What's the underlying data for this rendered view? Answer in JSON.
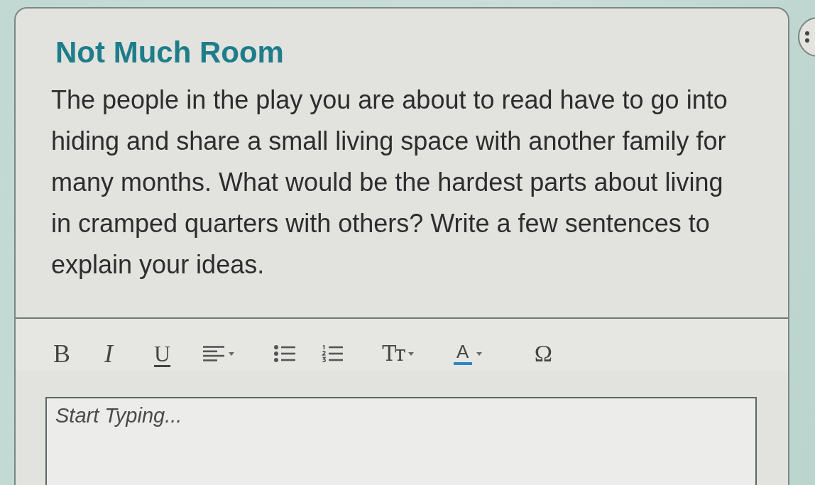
{
  "question": {
    "title": "Not Much Room",
    "prompt": "The people in the play you are about to read have to go into hiding and share a small living space with another family for many months. What would be the hardest parts about living in cramped quarters with others? Write a few sentences to explain your ideas."
  },
  "toolbar": {
    "buttons": [
      {
        "kind": "bold",
        "label": "B",
        "dropdown": false
      },
      {
        "kind": "italic",
        "label": "I",
        "dropdown": false
      },
      {
        "kind": "underline",
        "label": "U",
        "dropdown": false
      },
      {
        "kind": "align",
        "dropdown": true
      },
      {
        "kind": "bullet_list",
        "dropdown": false
      },
      {
        "kind": "numbered_list",
        "dropdown": false
      },
      {
        "kind": "text_size",
        "label": "Tᴛ",
        "dropdown": true
      },
      {
        "kind": "text_color",
        "label": "A",
        "color": "#2e86c6",
        "dropdown": true
      },
      {
        "kind": "special_character",
        "label": "Ω",
        "dropdown": false
      }
    ]
  },
  "editor": {
    "placeholder": "Start Typing..."
  }
}
